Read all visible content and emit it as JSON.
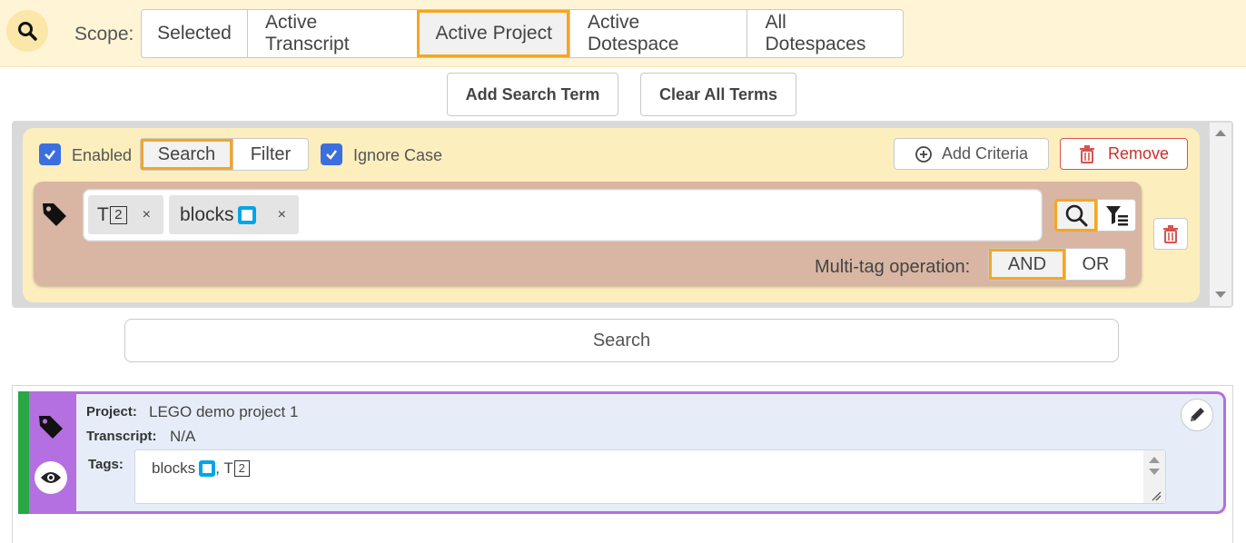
{
  "scope": {
    "label": "Scope:",
    "options": [
      "Selected",
      "Active Transcript",
      "Active Project",
      "Active Dotespace",
      "All Dotespaces"
    ],
    "selected": "Active Project"
  },
  "actions": {
    "add_term": "Add Search Term",
    "clear_terms": "Clear All Terms"
  },
  "criteria": {
    "enabled_label": "Enabled",
    "mode_options": [
      "Search",
      "Filter"
    ],
    "mode_selected": "Search",
    "ignore_case_label": "Ignore Case",
    "add_criteria": "Add Criteria",
    "remove": "Remove",
    "tags": [
      {
        "text": "T",
        "badge": "2"
      },
      {
        "text": "blocks",
        "badge": ""
      }
    ],
    "remove_chip": "×",
    "multi_tag_label": "Multi-tag operation:",
    "multi_tag_options": [
      "AND",
      "OR"
    ],
    "multi_tag_selected": "AND"
  },
  "search_button": "Search",
  "result": {
    "project_label": "Project:",
    "project_value": "LEGO demo project 1",
    "transcript_label": "Transcript:",
    "transcript_value": "N/A",
    "tags_label": "Tags:",
    "tags_text_1": "blocks",
    "tags_sep": ", T",
    "tags_badge": "2"
  },
  "colors": {
    "accent_orange": "#f5a623",
    "checkbox_blue": "#3b6fe0",
    "status_green": "#28a745",
    "result_purple": "#b46fe0",
    "danger_red": "#d9534f"
  }
}
